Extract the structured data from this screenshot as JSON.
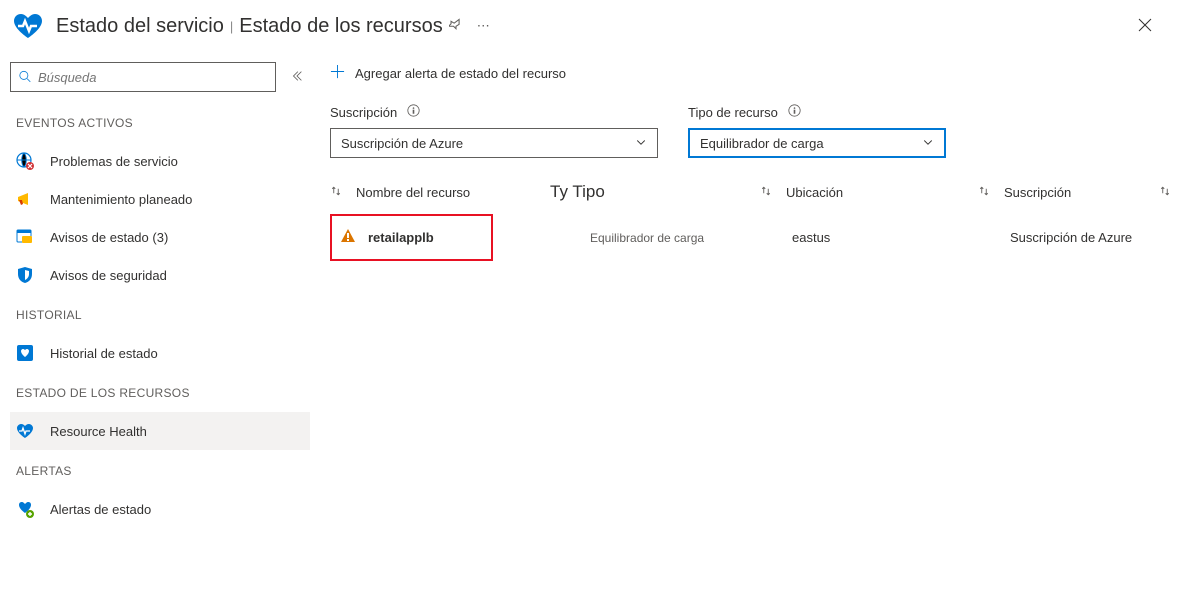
{
  "header": {
    "title": "Estado del servicio",
    "subtitle": "Estado de los recursos"
  },
  "sidebar": {
    "search_placeholder": "Búsqueda",
    "sections": {
      "active": "EVENTOS ACTIVOS",
      "history": "HISTORIAL",
      "resource": "ESTADO DE LOS RECURSOS",
      "alerts": "ALERTAS"
    },
    "items": {
      "service_issues": "Problemas de servicio",
      "planned_maint": "Mantenimiento planeado",
      "health_adv": "Avisos de estado (3)",
      "security_adv": "Avisos de seguridad",
      "health_history": "Historial de estado",
      "resource_health": "Resource Health",
      "health_alerts": "Alertas de estado"
    }
  },
  "command": {
    "add_alert": "Agregar alerta de estado del recurso"
  },
  "filters": {
    "sub_label": "Suscripción",
    "sub_value": "Suscripción de Azure",
    "type_label": "Tipo de recurso",
    "type_value": "Equilibrador de carga"
  },
  "table": {
    "headers": {
      "name": "Nombre del recurso",
      "tytipo": "Ty Tipo",
      "loc": "Ubicación",
      "sub": "Suscripción"
    },
    "row": {
      "name": "retailapplb",
      "type": "Equilibrador de carga",
      "loc": "eastus",
      "sub": "Suscripción de Azure"
    }
  }
}
